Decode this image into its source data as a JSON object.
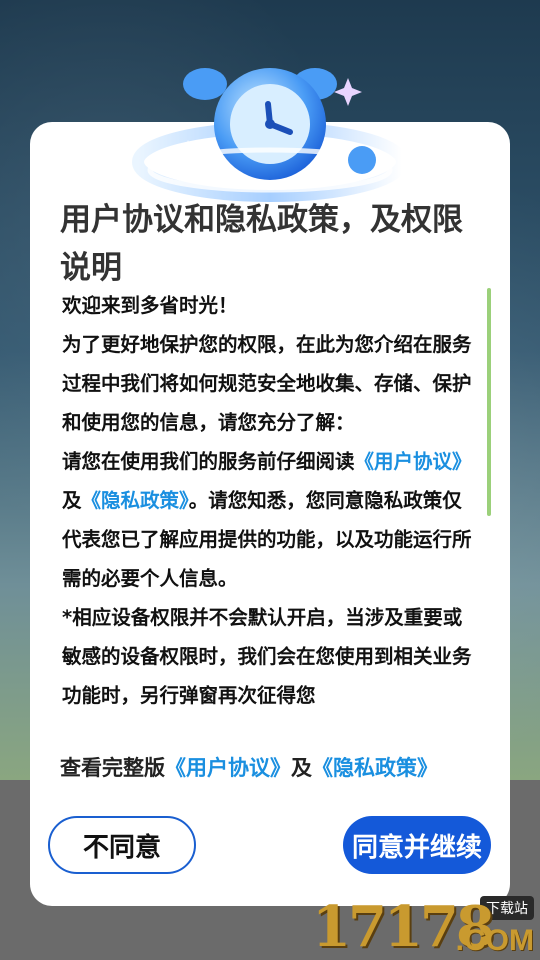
{
  "dialog": {
    "title": "用户协议和隐私政策，及权限说明",
    "body": {
      "greeting": "欢迎来到多省时光！",
      "intro": "为了更好地保护您的权限，在此为您介绍在服务过程中我们将如何规范安全地收集、存储、保护和使用您的信息，请您充分了解：",
      "read_prefix": "请您在使用我们的服务前仔细阅读",
      "link_user_agreement": "《用户协议》",
      "and": "及",
      "link_privacy_policy": "《隐私政策》",
      "read_suffix": "。请您知悉，您同意隐私政策仅代表您已了解应用提供的功能，以及功能运行所需的必要个人信息。",
      "permission_note": "*相应设备权限并不会默认开启，当涉及重要或敏感的设备权限时，我们会在您使用到相关业务功能时，另行弹窗再次征得您"
    },
    "footer": {
      "prefix": "查看完整版",
      "link_user_agreement": "《用户协议》",
      "and": "及",
      "link_privacy_policy": "《隐私政策》"
    },
    "buttons": {
      "disagree": "不同意",
      "agree": "同意并继续"
    }
  },
  "watermark": {
    "numbers": "17178",
    "domain": ".COM",
    "tag": "下载站"
  },
  "colors": {
    "link": "#1a8fe0",
    "primary": "#1459d9",
    "scroll": "#9bd07a"
  },
  "icons": {
    "hero": "alarm-clock-icon"
  }
}
